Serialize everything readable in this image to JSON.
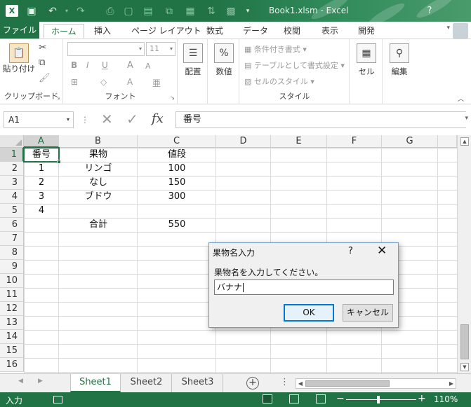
{
  "window": {
    "title": "Book1.xlsm - Excel",
    "help": "?"
  },
  "ribbon_tabs": {
    "file": "ファイル",
    "home": "ホーム",
    "insert": "挿入",
    "page_layout": "ページ レイアウト",
    "formulas": "数式",
    "data": "データ",
    "review": "校閲",
    "view": "表示",
    "developer": "開発"
  },
  "ribbon": {
    "clipboard": {
      "paste": "貼り付け",
      "label": "クリップボード"
    },
    "font": {
      "size": "11",
      "bold": "B",
      "italic": "I",
      "underline": "U",
      "grow": "A",
      "shrink": "A",
      "label": "フォント"
    },
    "alignment": {
      "label": "配置"
    },
    "number": {
      "symbol": "%",
      "label": "数値"
    },
    "styles": {
      "conditional": "条件付き書式",
      "table": "テーブルとして書式設定",
      "cell_styles": "セルのスタイル",
      "label": "スタイル"
    },
    "cells": {
      "label": "セル"
    },
    "editing": {
      "label": "編集"
    }
  },
  "formula_bar": {
    "name_box": "A1",
    "fx": "fx",
    "content": "番号"
  },
  "columns": [
    "A",
    "B",
    "C",
    "D",
    "E",
    "F",
    "G"
  ],
  "rows": [
    "1",
    "2",
    "3",
    "4",
    "5",
    "6",
    "7",
    "8",
    "9",
    "10",
    "11",
    "12",
    "13",
    "14",
    "15",
    "16"
  ],
  "cells": {
    "A1": "番号",
    "B1": "果物",
    "C1": "値段",
    "A2": "1",
    "B2": "リンゴ",
    "C2": "100",
    "A3": "2",
    "B3": "なし",
    "C3": "150",
    "A4": "3",
    "B4": "ブドウ",
    "C4": "300",
    "A5": "4",
    "B6": "合計",
    "C6": "550"
  },
  "sheets": [
    "Sheet1",
    "Sheet2",
    "Sheet3"
  ],
  "active_sheet": "Sheet1",
  "status": {
    "mode": "入力",
    "zoom": "110%"
  },
  "dialog": {
    "title": "果物名入力",
    "help": "?",
    "close": "✕",
    "prompt": "果物名を入力してください。",
    "input_value": "バナナ",
    "ok": "OK",
    "cancel": "キャンセル"
  },
  "colors": {
    "excel_green": "#217346",
    "dialog_border": "#6f9bc6",
    "ok_focus": "#0078d7"
  }
}
